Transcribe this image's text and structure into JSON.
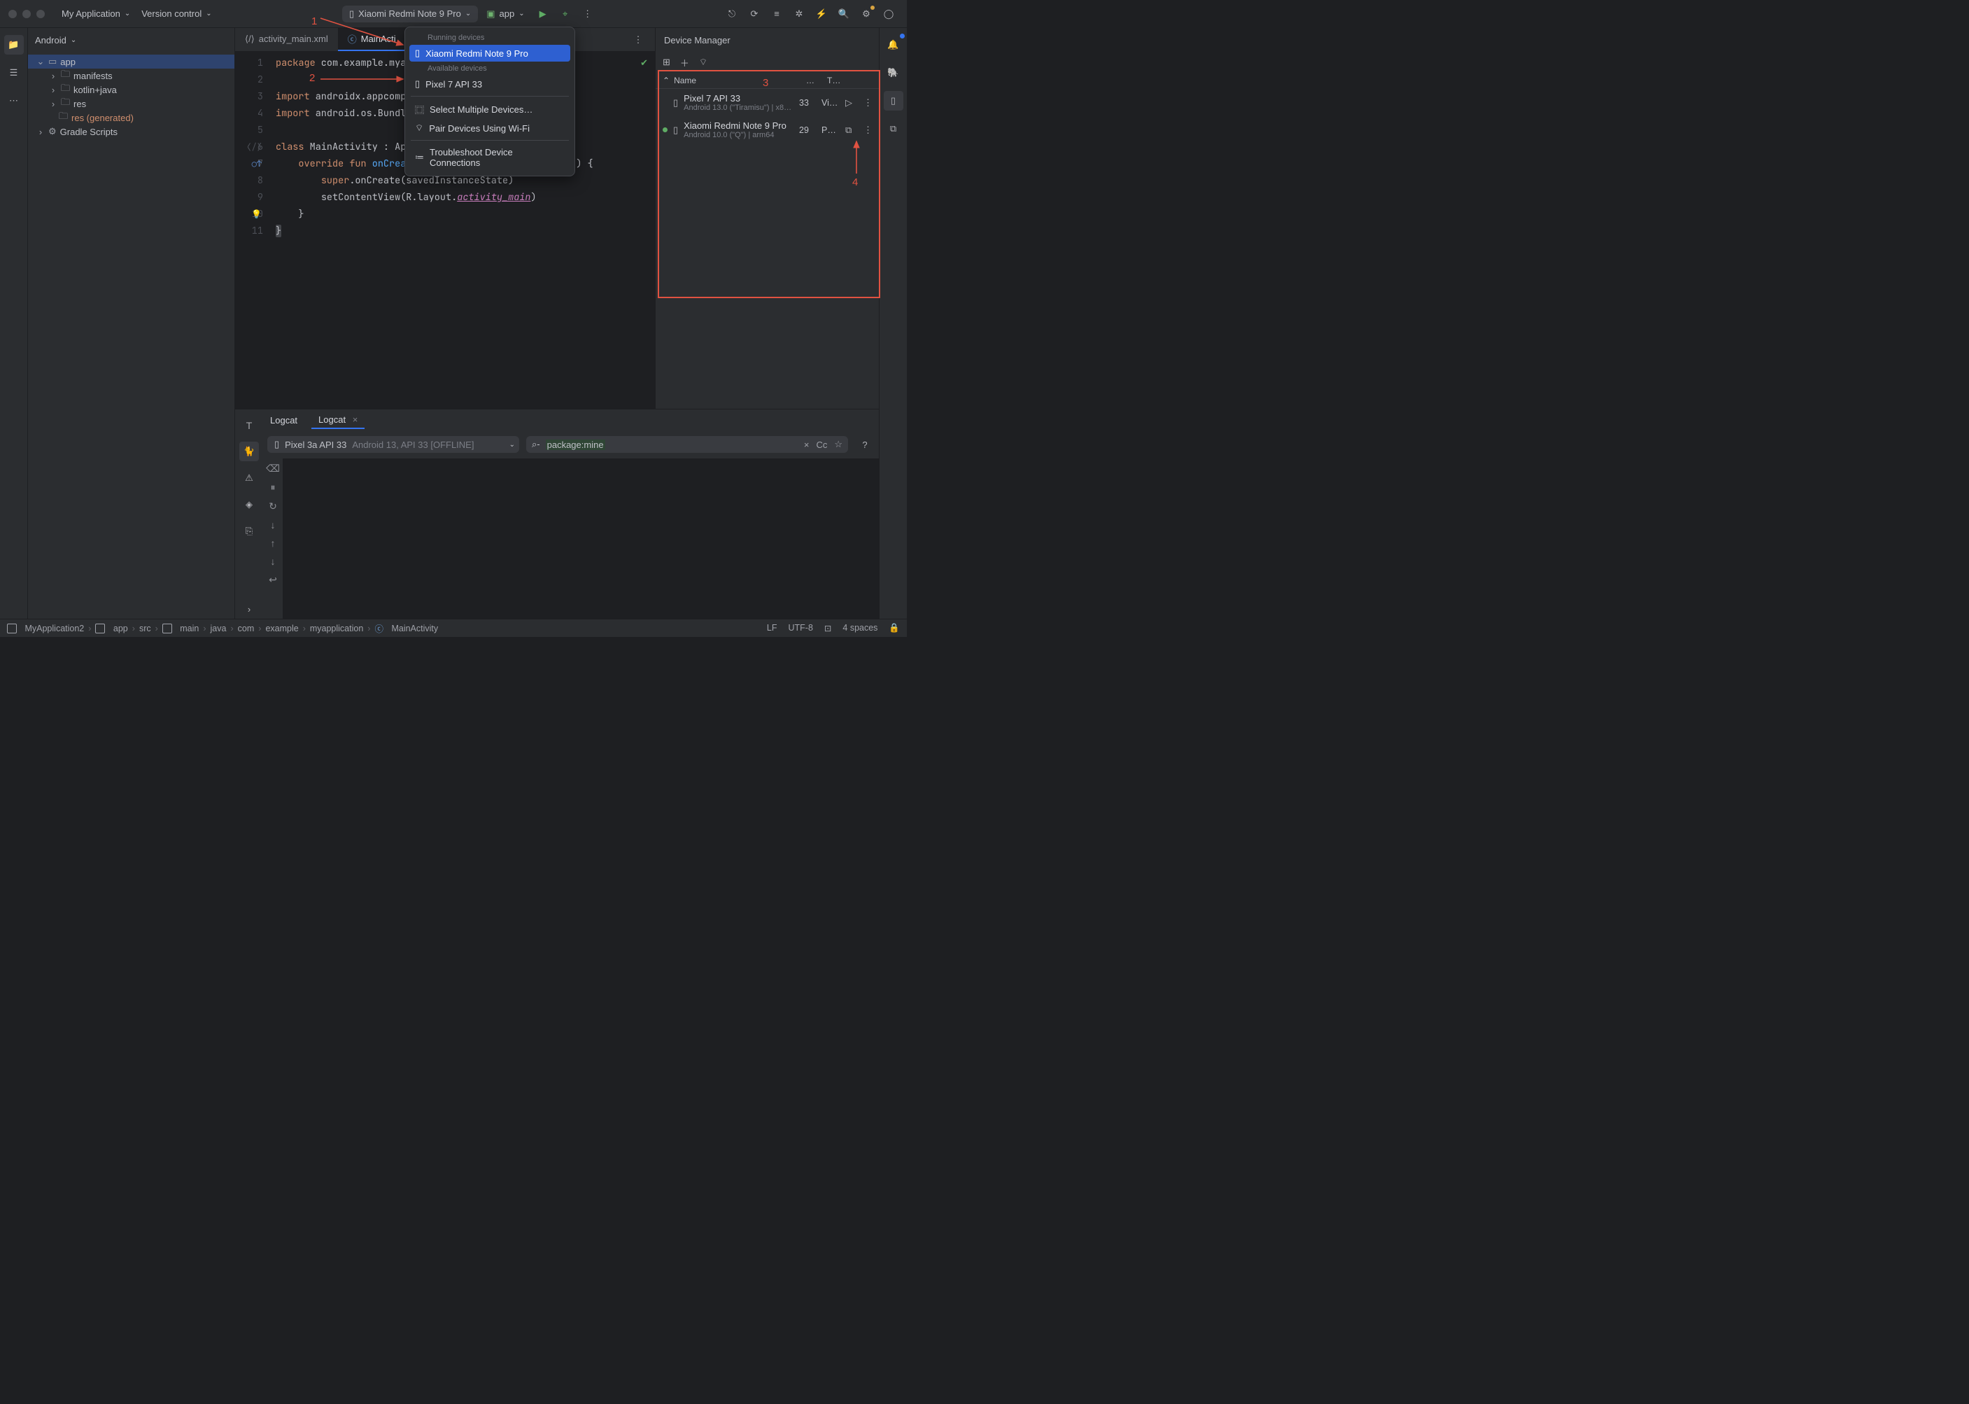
{
  "titlebar": {
    "app_menu": "My Application",
    "vcs_menu": "Version control",
    "device_selected": "Xiaomi Redmi Note 9 Pro",
    "run_config": "app"
  },
  "project": {
    "panel_label": "Android",
    "root": "app",
    "children": {
      "manifests": "manifests",
      "kotlin_java": "kotlin+java",
      "res": "res",
      "res_gen": "res (generated)"
    },
    "gradle": "Gradle Scripts"
  },
  "editor_tabs": {
    "tab1": "activity_main.xml",
    "tab2": "MainActi"
  },
  "code": {
    "l1_kw": "package",
    "l1_rest": " com.example.mya",
    "l3_kw": "import",
    "l3_rest": " androidx.appcomp",
    "l4_kw": "import",
    "l4_rest": " android.os.Bundl",
    "l6_kw1": "class",
    "l6_name": " MainActivity ",
    "l6_colon": ": ",
    "l6_sup": "AppCompatActivity",
    "l6_par": "() ",
    "l6_brace": "{",
    "l7_kw1": "override",
    "l7_kw2": " fun ",
    "l7_fn": "onCreate",
    "l7_par": "(savedInstanceState: Bundle?) ",
    "l7_brace": "{",
    "l8_kw": "super",
    "l8_rest1": ".onCreate(savedInstanceState)",
    "l9_call": "setContentView(R.layout.",
    "l9_it": "activity_main",
    "l9_close": ")",
    "l10": "}",
    "l11": "}"
  },
  "line_numbers": [
    "1",
    "2",
    "3",
    "4",
    "5",
    "6",
    "7",
    "8",
    "9",
    "10",
    "11"
  ],
  "popup": {
    "running_label": "Running devices",
    "running_item": "Xiaomi Redmi Note 9 Pro",
    "available_label": "Available devices",
    "available_item": "Pixel 7 API 33",
    "multi": "Select Multiple Devices…",
    "pair": "Pair Devices Using Wi-Fi",
    "troubleshoot": "Troubleshoot Device Connections"
  },
  "device_manager": {
    "title": "Device Manager",
    "col_name": "Name",
    "col_api_short": "…",
    "col_type_short": "T…",
    "dev1_name": "Pixel 7 API 33",
    "dev1_sub": "Android 13.0 (\"Tiramisu\") | x86_64",
    "dev1_api": "33",
    "dev1_type": "Vi…",
    "dev2_name": "Xiaomi Redmi Note 9 Pro",
    "dev2_sub": "Android 10.0 (\"Q\") | arm64",
    "dev2_api": "29",
    "dev2_type": "P…"
  },
  "logcat": {
    "header_tab": "Logcat",
    "sub_tab": "Logcat",
    "device_prefix": "Pixel 3a API 33",
    "device_suffix": "Android 13, API 33 [OFFLINE]",
    "filter_query": "package:mine",
    "cc": "Cc"
  },
  "breadcrumbs": {
    "c1": "MyApplication2",
    "c2": "app",
    "c3": "src",
    "c4": "main",
    "c5": "java",
    "c6": "com",
    "c7": "example",
    "c8": "myapplication",
    "c9": "MainActivity"
  },
  "status": {
    "lf": "LF",
    "enc": "UTF-8",
    "indent": "4 spaces"
  },
  "annotations": {
    "a1": "1",
    "a2": "2",
    "a3": "3",
    "a4": "4"
  }
}
